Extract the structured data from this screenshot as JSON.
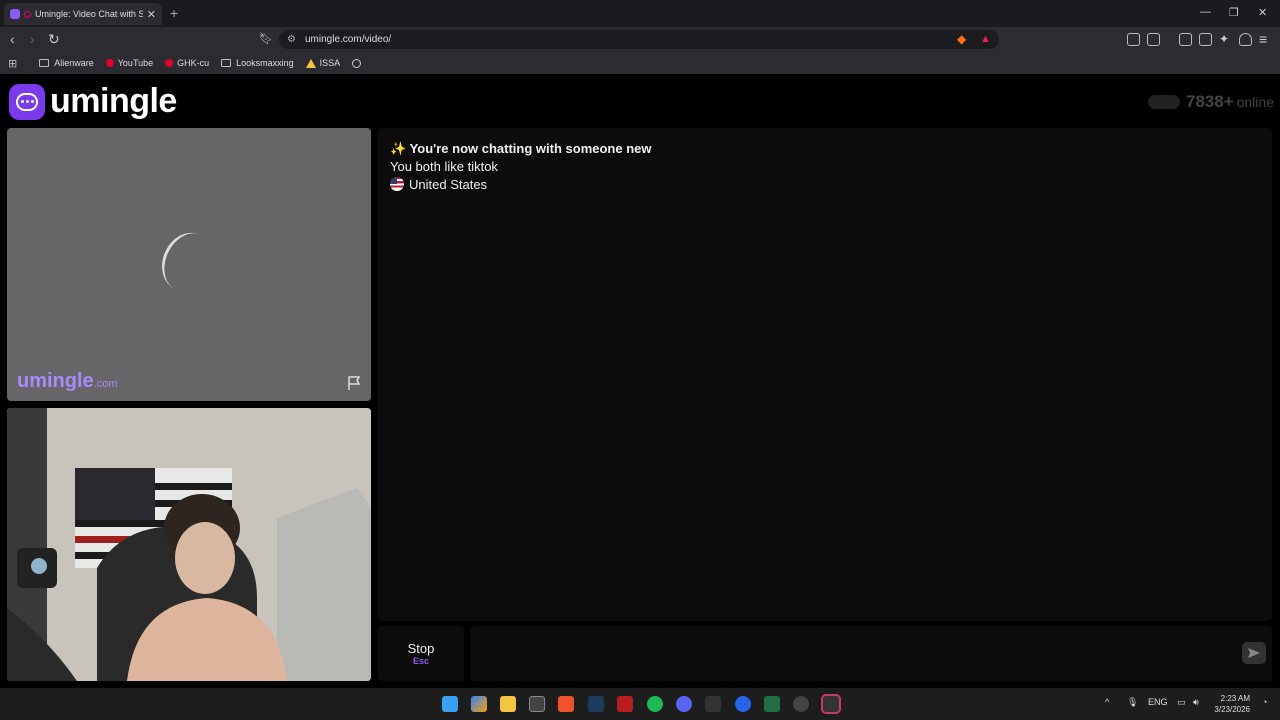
{
  "browser": {
    "tab_title": "Umingle: Video Chat with Stra",
    "url": "umingle.com/video/",
    "bookmarks": [
      "Alienware",
      "YouTube",
      "GHK-cu",
      "Looksmaxxing",
      "ISSA"
    ]
  },
  "header": {
    "logo_text": "umingle",
    "online_count": "7838+",
    "online_label": "online"
  },
  "stranger_panel": {
    "watermark_name": "umingle",
    "watermark_tld": ".com"
  },
  "chat": {
    "headline": "✨ You're now chatting with someone new",
    "interest": "You both like tiktok",
    "country": "United States"
  },
  "controls": {
    "stop_label": "Stop",
    "stop_key": "Esc"
  },
  "system": {
    "language": "ENG",
    "time": "2:23 AM",
    "date": "3/23/2026"
  }
}
